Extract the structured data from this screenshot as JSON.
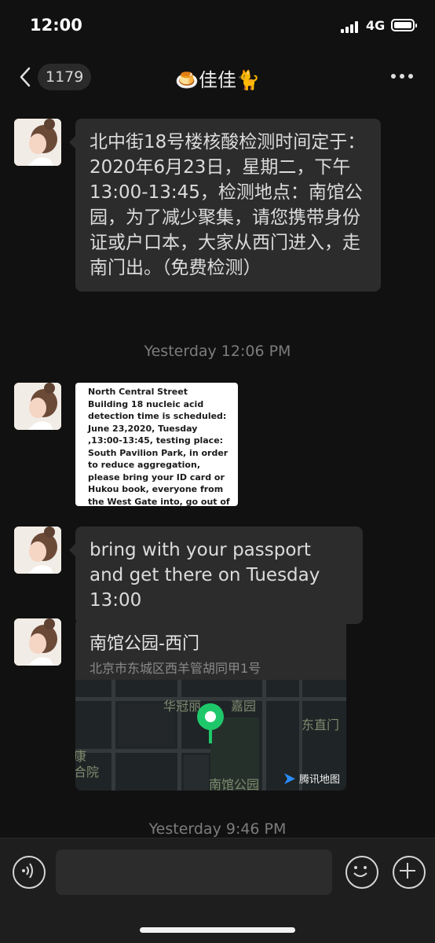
{
  "status_bar": {
    "time": "12:00",
    "network": "4G",
    "battery_level_percent": 80
  },
  "nav": {
    "unread_count": "1179",
    "title": "🍮佳佳🐈"
  },
  "messages": [
    {
      "type": "text",
      "text": "北中街18号楼核酸检测时间定于：2020年6月23日，星期二，下午13:00-13:45，检测地点：南馆公园，为了减少聚集，请您携带身份证或户口本，大家从西门进入，走南门出。（免费检测）"
    },
    {
      "type": "timestamp",
      "text": "Yesterday 12:06 PM"
    },
    {
      "type": "image",
      "text": "North Central Street Building 18 nucleic acid detection time is scheduled: June 23,2020, Tuesday ,13:00-13:45, testing place: South Pavilion Park, in order to reduce aggregation, please bring your ID card or Hukou book, everyone from the West Gate into, go out of the South Gate. (Free testing)"
    },
    {
      "type": "text",
      "text": "bring with your passport and get there on Tuesday 13:00"
    },
    {
      "type": "location",
      "title": "南馆公园-西门",
      "address": "北京市东城区西羊管胡同甲1号",
      "map_labels": {
        "top_left": "华冠丽",
        "top_mid": "嘉园",
        "right": "东直门",
        "left_a": "康",
        "left_b": "合院",
        "bottom": "南馆公园",
        "provider": "腾讯地图"
      }
    },
    {
      "type": "timestamp",
      "text": "Yesterday 9:46 PM"
    }
  ],
  "input_bar": {
    "placeholder": ""
  },
  "colors": {
    "background": "#111111",
    "bubble": "#2c2c2c",
    "map_pin": "#1ec86a"
  }
}
